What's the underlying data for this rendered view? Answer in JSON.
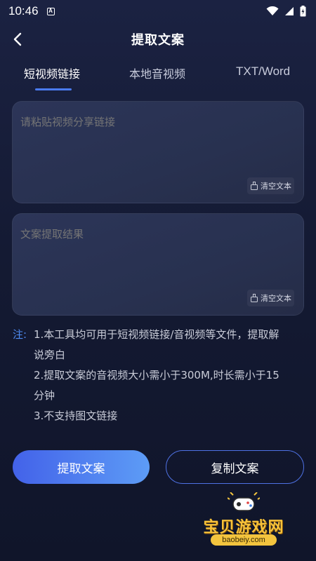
{
  "status_bar": {
    "time": "10:46",
    "a_icon": "A"
  },
  "header": {
    "title": "提取文案"
  },
  "tabs": [
    {
      "label": "短视频链接",
      "active": true
    },
    {
      "label": "本地音视频",
      "active": false
    },
    {
      "label": "TXT/Word",
      "active": false
    }
  ],
  "input_panel": {
    "placeholder": "请粘贴视频分享链接",
    "clear_label": "清空文本"
  },
  "result_panel": {
    "placeholder": "文案提取结果",
    "clear_label": "清空文本"
  },
  "notes": {
    "label": "注:",
    "lines": [
      "1.本工具均可用于短视频链接/音视频等文件，提取解",
      "说旁白",
      "2.提取文案的音视频大小需小于300M,时长需小于15",
      "分钟",
      "3.不支持图文链接"
    ]
  },
  "buttons": {
    "extract_label": "提取文案",
    "copy_label": "复制文案"
  },
  "watermark": {
    "text": "宝贝游戏网",
    "url": "baobeiy.com"
  },
  "colors": {
    "accent": "#4f8cf5",
    "button_gradient_start": "#4362e9",
    "button_gradient_end": "#5d9cf6",
    "background": "#141a33"
  },
  "icons": [
    "wifi-icon",
    "signal-icon",
    "battery-icon",
    "back-arrow-icon",
    "broom-icon",
    "gamepad-icon"
  ]
}
